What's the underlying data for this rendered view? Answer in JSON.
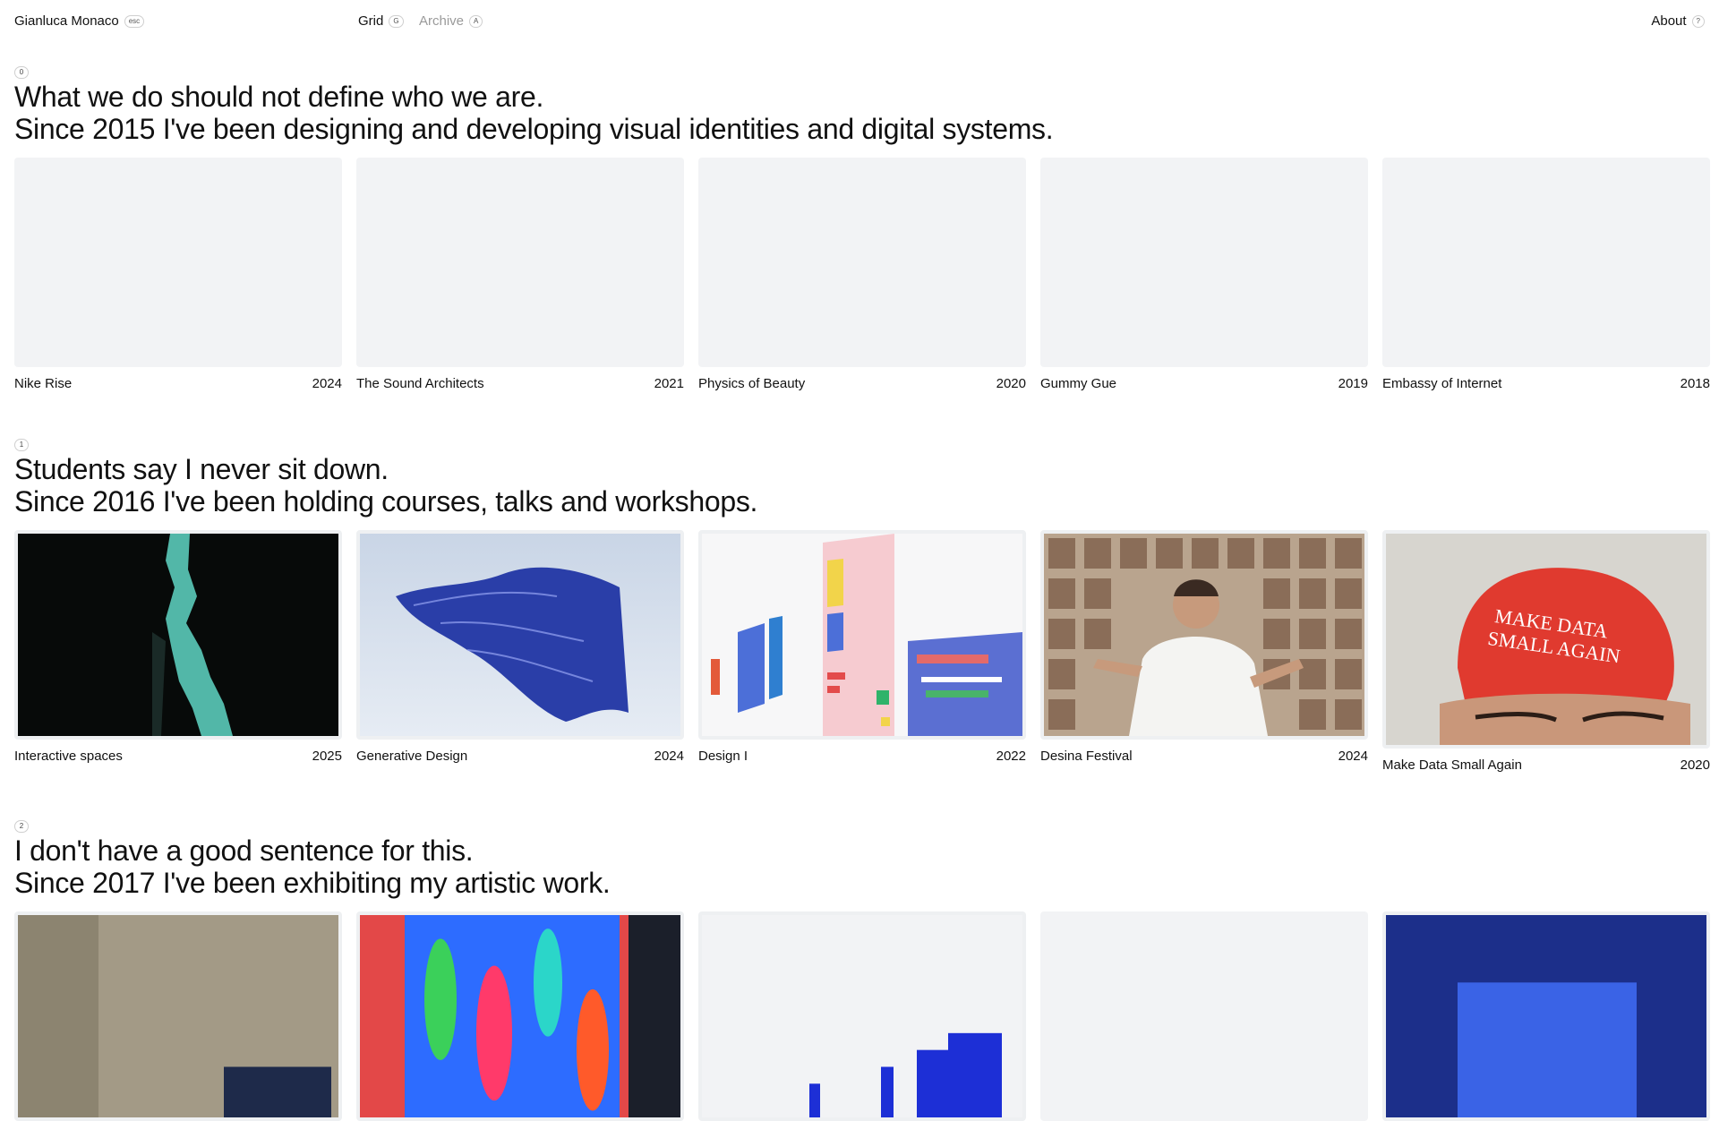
{
  "header": {
    "name": "Gianluca Monaco",
    "name_key": "esc",
    "nav": [
      {
        "label": "Grid",
        "key": "G"
      },
      {
        "label": "Archive",
        "key": "A"
      }
    ],
    "about": {
      "label": "About",
      "key": "?"
    }
  },
  "sections": [
    {
      "index": "0",
      "line1": "What we do should not define who we are.",
      "line2": "Since 2015 I've been designing and developing visual identities and digital systems.",
      "items": [
        {
          "title": "Nike Rise",
          "year": "2024"
        },
        {
          "title": "The Sound Architects",
          "year": "2021"
        },
        {
          "title": "Physics of Beauty",
          "year": "2020"
        },
        {
          "title": "Gummy Gue",
          "year": "2019"
        },
        {
          "title": "Embassy of Internet",
          "year": "2018"
        }
      ]
    },
    {
      "index": "1",
      "line1": "Students say I never sit down.",
      "line2": "Since 2016 I've been holding courses, talks and workshops.",
      "items": [
        {
          "title": "Interactive spaces",
          "year": "2025"
        },
        {
          "title": "Generative Design",
          "year": "2024"
        },
        {
          "title": "Design I",
          "year": "2022"
        },
        {
          "title": "Desina Festival",
          "year": "2024"
        },
        {
          "title": "Make Data Small Again",
          "year": "2020",
          "cap_text_1": "MAKE DATA",
          "cap_text_2": "SMALL AGAIN"
        }
      ]
    },
    {
      "index": "2",
      "line1": "I don't have a good sentence for this.",
      "line2": "Since 2017 I've been exhibiting my artistic work."
    }
  ]
}
